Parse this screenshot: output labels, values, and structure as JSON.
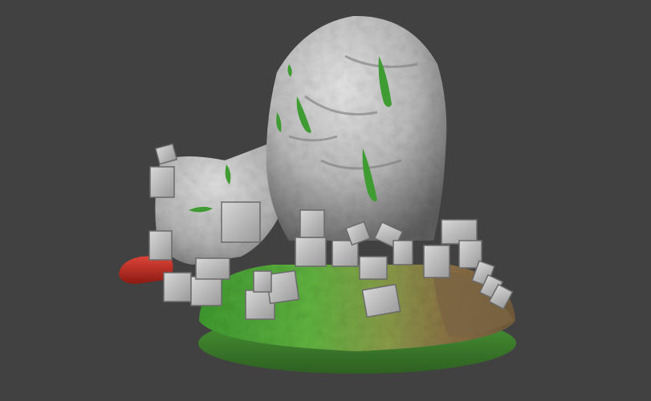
{
  "scene": {
    "background_color": "#414141",
    "subject": "sculpted-rock-mound-with-scattered-stone-blocks",
    "colors": {
      "rock": "#c9c9c9",
      "rock_shadow": "#6f6f6f",
      "moss": "#3f9c32",
      "base_green": "#4fa83a",
      "base_brown": "#8a6f45",
      "red_object": "#b8281e"
    }
  }
}
